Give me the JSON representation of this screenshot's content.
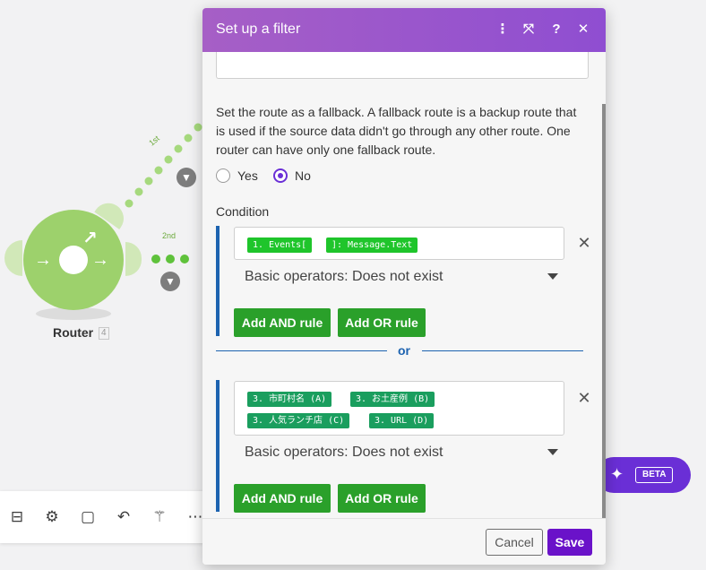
{
  "canvas": {
    "router_label": "Router",
    "router_count": "4",
    "route_labels": [
      "1st",
      "2nd"
    ],
    "beta_label": "BETA"
  },
  "toolbar": {
    "icons": [
      "run-once-icon",
      "settings-icon",
      "notes-icon",
      "undo-icon",
      "magic-wand-icon",
      "more-icon"
    ]
  },
  "dialog": {
    "title": "Set up a filter",
    "fallback_description": "Set the route as a fallback. A fallback route is a backup route that is used if the source data didn't go through any other route. One router can have only one fallback route.",
    "fallback_options": [
      {
        "label": "Yes",
        "selected": false
      },
      {
        "label": "No",
        "selected": true
      }
    ],
    "condition_label": "Condition",
    "rule_groups": [
      {
        "tokens": [
          "1. Events[",
          "]: Message.Text"
        ],
        "operator": "Basic operators: Does not exist",
        "add_and_label": "Add AND rule",
        "add_or_label": "Add OR rule"
      },
      {
        "tokens": [
          "3. 市町村名 (A)",
          "3. お土産例 (B)",
          "3. 人気ランチ店 (C)",
          "3. URL (D)"
        ],
        "operator": "Basic operators: Does not exist",
        "add_and_label": "Add AND rule",
        "add_or_label": "Add OR rule"
      }
    ],
    "separator_label": "or",
    "cancel_label": "Cancel",
    "save_label": "Save"
  },
  "colors": {
    "header_gradient_start": "#a65fc6",
    "header_gradient_end": "#8f4ed1",
    "accent_purple": "#6a12c9",
    "rule_border_blue": "#1d63b0",
    "button_green": "#2aa02a",
    "router_green": "#9dd16c"
  }
}
